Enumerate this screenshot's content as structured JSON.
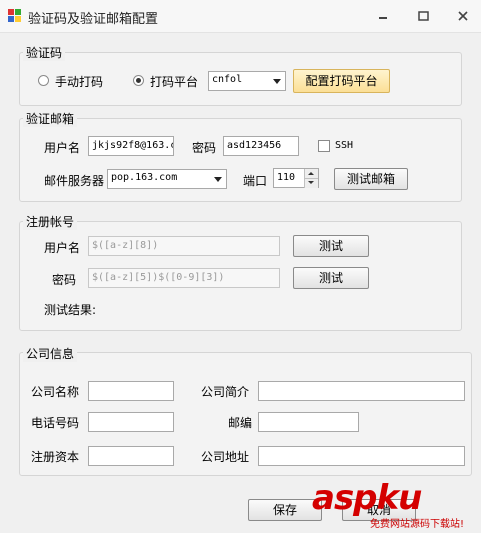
{
  "window": {
    "title": "验证码及验证邮箱配置"
  },
  "captcha": {
    "title": "验证码",
    "manual_label": "手动打码",
    "platform_label": "打码平台",
    "platform_value": "cnfol",
    "config_button": "配置打码平台"
  },
  "email": {
    "title": "验证邮箱",
    "username_label": "用户名",
    "username_value": "jkjs92f8@163.c",
    "password_label": "密码",
    "password_value": "asd123456",
    "ssh_label": "SSH",
    "server_label": "邮件服务器",
    "server_value": "pop.163.com",
    "port_label": "端口",
    "port_value": "110",
    "test_button": "测试邮箱"
  },
  "register": {
    "title": "注册帐号",
    "username_label": "用户名",
    "username_pattern": "$([a-z][8])",
    "username_test": "测试",
    "password_label": "密码",
    "password_pattern": "$([a-z][5])$([0-9][3])",
    "password_test": "测试",
    "result_label": "测试结果:"
  },
  "company": {
    "title": "公司信息",
    "name_label": "公司名称",
    "intro_label": "公司简介",
    "phone_label": "电话号码",
    "zip_label": "邮编",
    "capital_label": "注册资本",
    "address_label": "公司地址"
  },
  "footer": {
    "save": "保存",
    "cancel": "取消"
  },
  "watermark": {
    "main": "aspku",
    "sub": "免费网站源码下载站!"
  }
}
